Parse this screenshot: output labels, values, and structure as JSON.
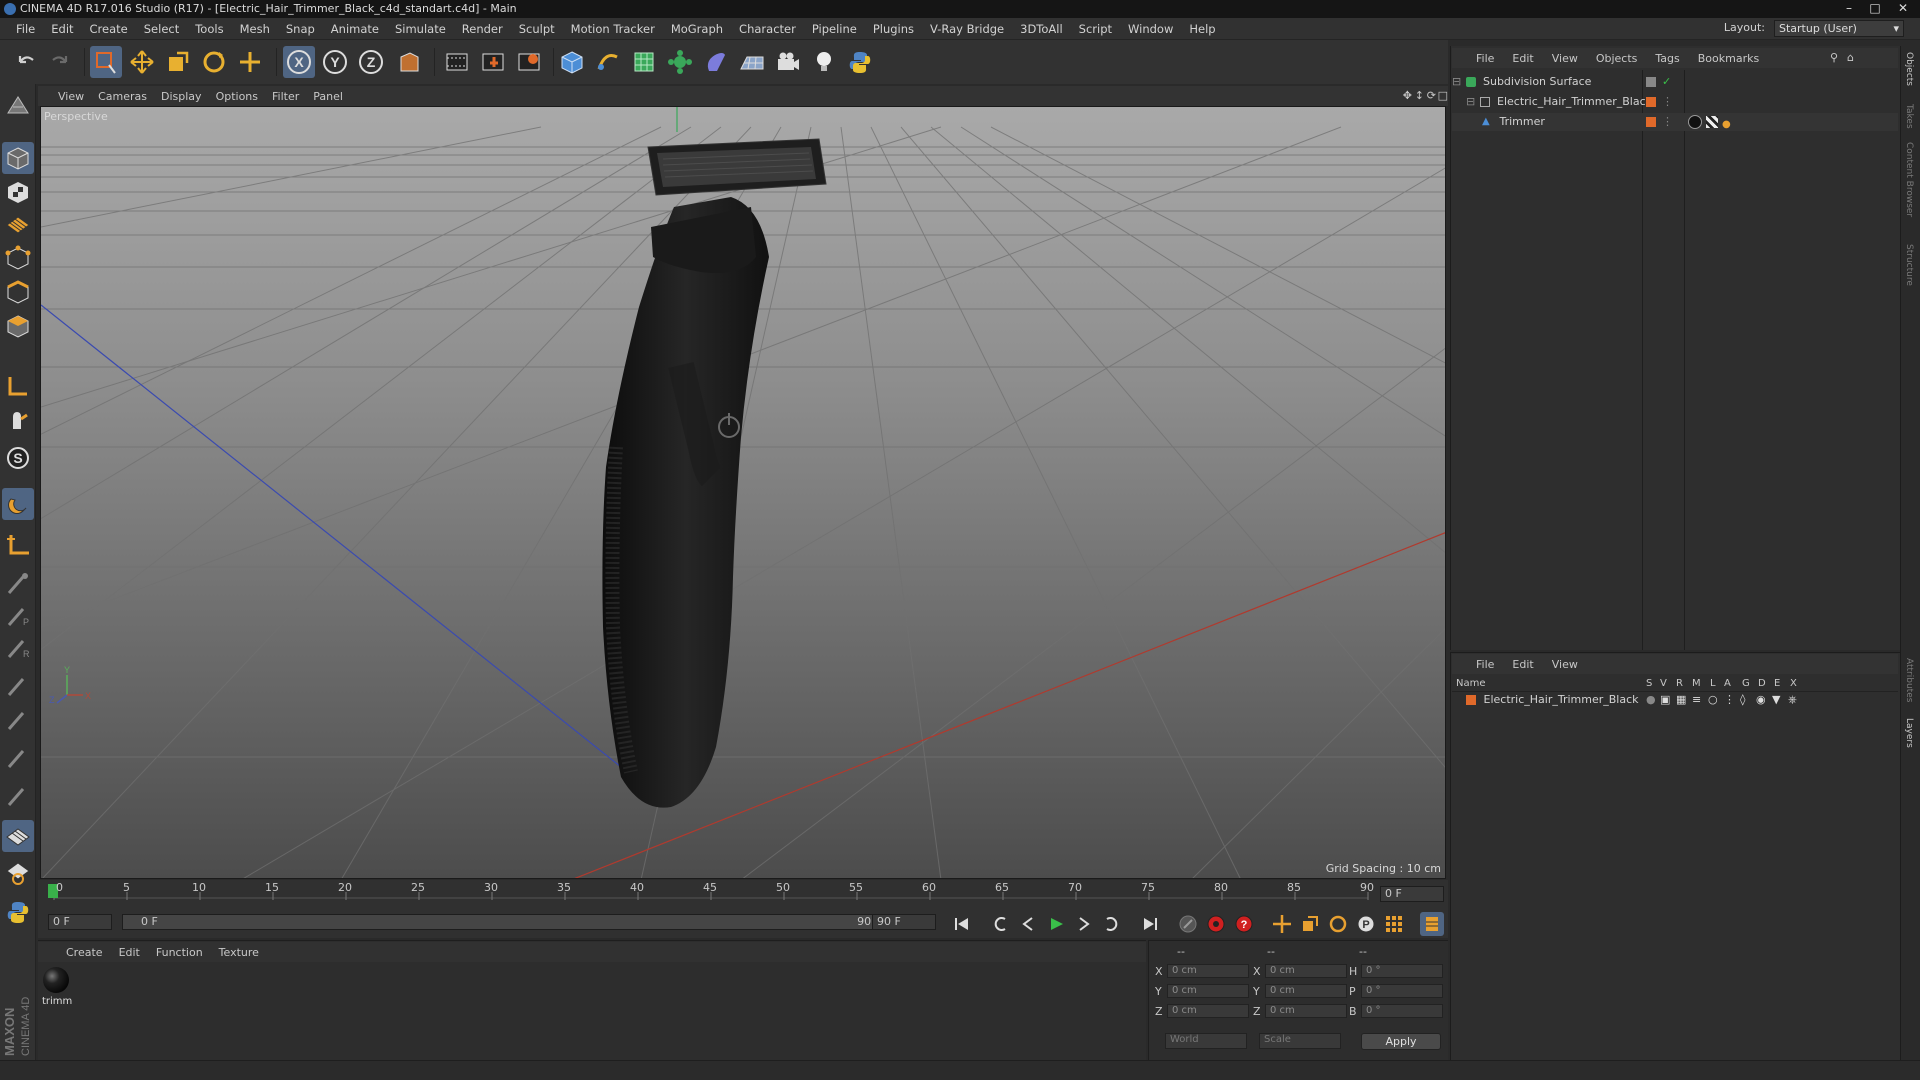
{
  "window": {
    "title": "CINEMA 4D R17.016 Studio (R17) - [Electric_Hair_Trimmer_Black_c4d_standart.c4d] - Main",
    "min_icon": "minimize-icon",
    "max_icon": "maximize-icon",
    "close_icon": "close-icon"
  },
  "menubar": {
    "items": [
      "File",
      "Edit",
      "Create",
      "Select",
      "Tools",
      "Mesh",
      "Snap",
      "Animate",
      "Simulate",
      "Render",
      "Sculpt",
      "Motion Tracker",
      "MoGraph",
      "Character",
      "Pipeline",
      "Plugins",
      "V-Ray Bridge",
      "3DToAll",
      "Script",
      "Window",
      "Help"
    ],
    "layout_label": "Layout:",
    "layout_value": "Startup (User)"
  },
  "toolbar": {
    "icons": [
      "undo-icon",
      "redo-icon",
      "live-selection-icon",
      "move-icon",
      "scale-icon",
      "rotate-icon",
      "last-tool-icon",
      "x-axis-icon",
      "y-axis-icon",
      "z-axis-icon",
      "coordinate-system-icon",
      "render-view-icon",
      "render-picture-viewer-icon",
      "edit-render-settings-icon",
      "cube-icon",
      "pen-spline-icon",
      "subdivision-surface-icon",
      "array-icon",
      "deformer-icon",
      "floor-icon",
      "camera-icon",
      "light-icon",
      "python-icon"
    ],
    "axis_x": "X",
    "axis_y": "Y",
    "axis_z": "Z"
  },
  "lefttools": {
    "icons": [
      "make-editable-icon",
      "model-mode-icon",
      "texture-mode-icon",
      "workplane-icon",
      "points-mode-icon",
      "edges-mode-icon",
      "polygons-mode-icon",
      "axis-mode-icon",
      "tweak-mode-icon",
      "solo-icon",
      "magnet-icon",
      "snap-icon",
      "brush-icon",
      "sculpt-icon",
      "workplane-lock-icon",
      "python-icon"
    ],
    "s_label": "S"
  },
  "viewport": {
    "menu": [
      "View",
      "Cameras",
      "Display",
      "Options",
      "Filter",
      "Panel"
    ],
    "label": "Perspective",
    "grid_spacing": "Grid Spacing : 10 cm",
    "axis_y": "Y",
    "axis_x": "X",
    "axis_z": "Z"
  },
  "timeline": {
    "ticks": [
      "0",
      "5",
      "10",
      "15",
      "20",
      "25",
      "30",
      "35",
      "40",
      "45",
      "50",
      "55",
      "60",
      "65",
      "70",
      "75",
      "80",
      "85",
      "90"
    ],
    "current_frame": "0 F",
    "start_field": "0 F",
    "range_start": "0 F",
    "range_end": "90 F",
    "end_field": "90 F"
  },
  "transport": {
    "icons": [
      "go-to-start-icon",
      "previous-key-icon",
      "previous-frame-icon",
      "play-icon",
      "next-frame-icon",
      "next-key-icon",
      "go-to-end-icon",
      "record-keys-icon",
      "autokey-icon",
      "keyframe-selection-icon",
      "position-key-icon",
      "scale-key-icon",
      "rotation-key-icon",
      "parameter-key-icon",
      "pla-key-icon",
      "timeline-icon"
    ],
    "p_label": "P"
  },
  "material_manager": {
    "menu": [
      "Create",
      "Edit",
      "Function",
      "Texture"
    ],
    "material_name": "trimm"
  },
  "coordinates": {
    "header": [
      "--",
      "--",
      "--"
    ],
    "rows": [
      {
        "axis": "X",
        "pos": "0 cm",
        "axis2": "X",
        "size": "0 cm",
        "rot_label": "H",
        "rot": "0 °"
      },
      {
        "axis": "Y",
        "pos": "0 cm",
        "axis2": "Y",
        "size": "0 cm",
        "rot_label": "P",
        "rot": "0 °"
      },
      {
        "axis": "Z",
        "pos": "0 cm",
        "axis2": "Z",
        "size": "0 cm",
        "rot_label": "B",
        "rot": "0 °"
      }
    ],
    "mode": "World",
    "size_mode": "Scale",
    "apply": "Apply"
  },
  "object_manager": {
    "menu": [
      "File",
      "Edit",
      "View",
      "Objects",
      "Tags",
      "Bookmarks"
    ],
    "objects": [
      {
        "name": "Subdivision Surface",
        "icon": "subdivision-surface-icon"
      },
      {
        "name": "Electric_Hair_Trimmer_Black",
        "icon": "null-object-icon"
      },
      {
        "name": "Trimmer",
        "icon": "polygon-object-icon"
      }
    ]
  },
  "layer_manager": {
    "menu": [
      "File",
      "Edit",
      "View"
    ],
    "columns": [
      "Name",
      "S",
      "V",
      "R",
      "M",
      "L",
      "A",
      "G",
      "D",
      "E",
      "X"
    ],
    "layers": [
      {
        "name": "Electric_Hair_Trimmer_Black",
        "color": "#e0692a"
      }
    ]
  },
  "side_tabs": [
    "Objects",
    "Takes",
    "Content Browser",
    "Structure",
    "Attributes",
    "Layers"
  ],
  "branding": {
    "logo_text": "MAXON CINEMA 4D"
  },
  "colors": {
    "accent": "#4f6583",
    "layer_orange": "#e0692a",
    "grid_x": "#b03a2e",
    "grid_z": "#3a4ab0"
  }
}
